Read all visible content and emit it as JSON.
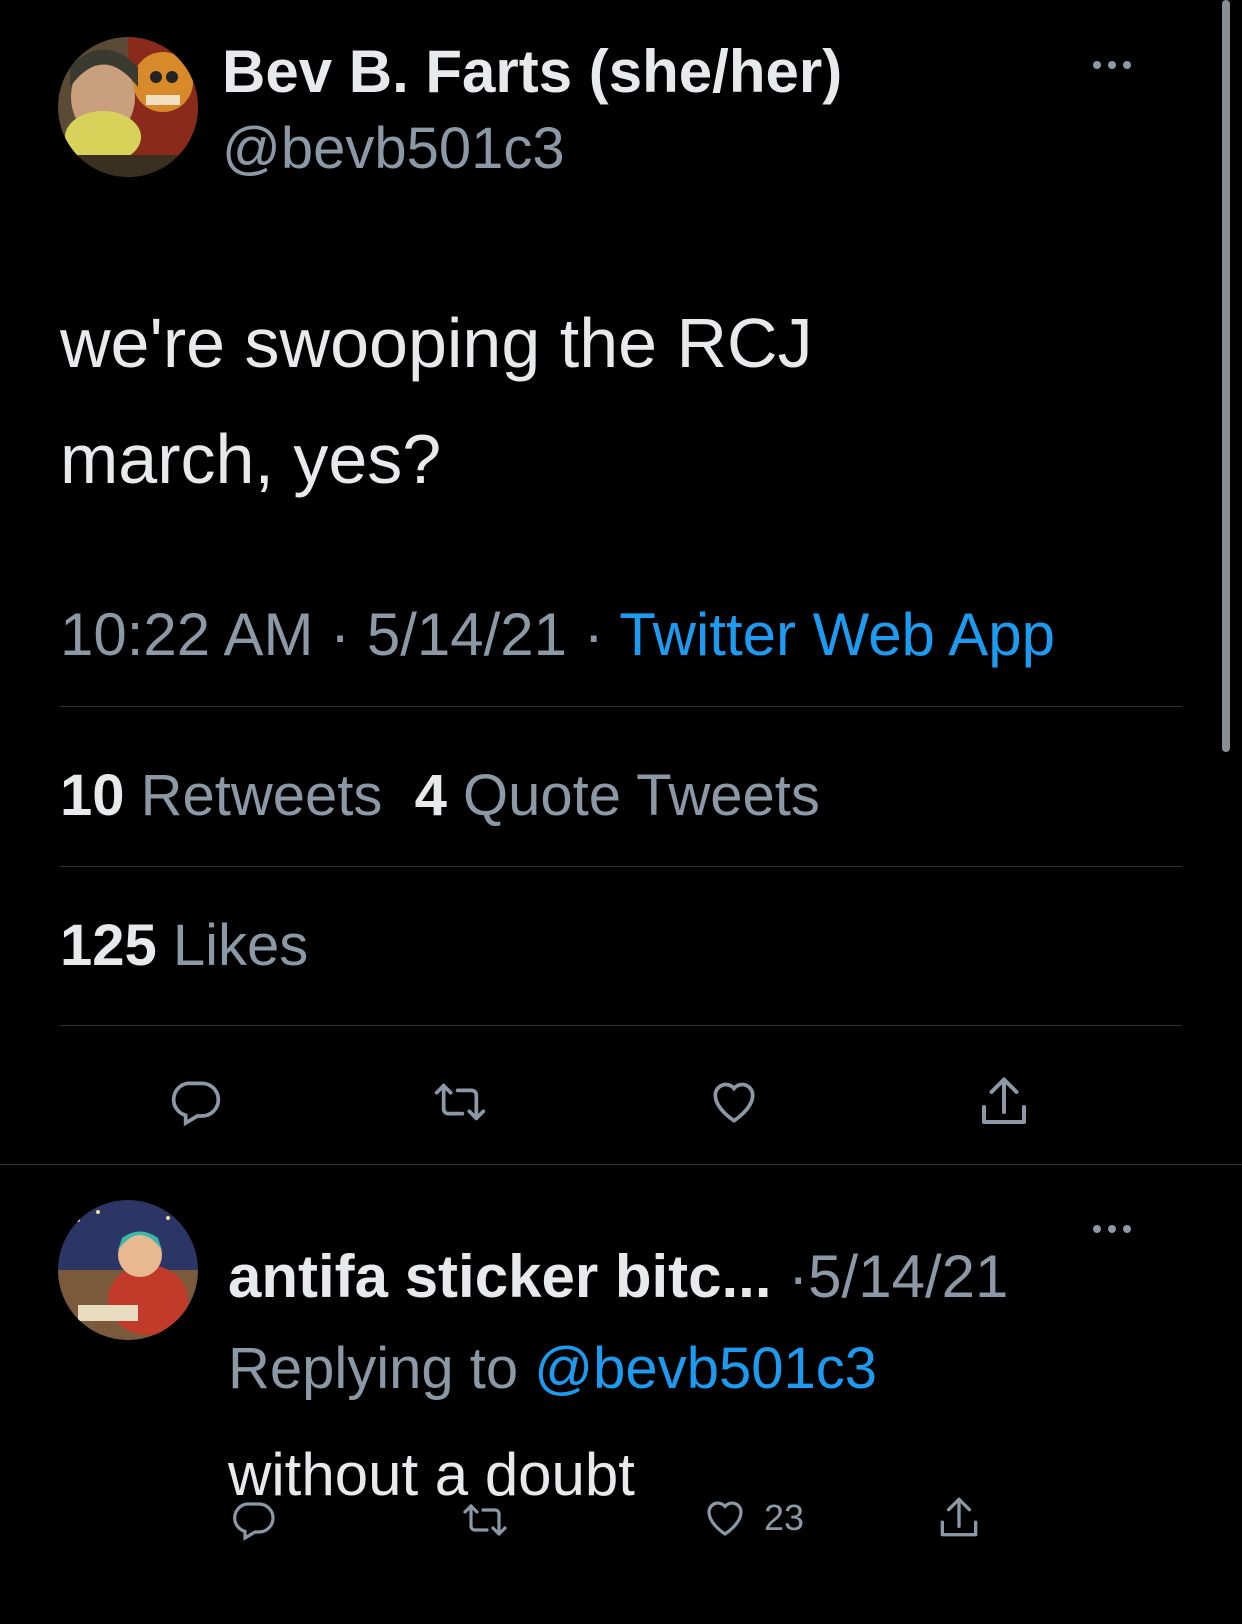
{
  "tweet": {
    "author_name": "Bev B. Farts (she/her)",
    "author_handle": "@bevb501c3",
    "text_line1": "we're swooping the RCJ",
    "text_line2": "march, yes?",
    "time": "10:22 AM",
    "sep1": " · ",
    "date": "5/14/21",
    "sep2": " · ",
    "source": "Twitter Web App",
    "retweets_count": "10",
    "retweets_label": "Retweets",
    "quotes_count": "4",
    "quotes_label": "Quote Tweets",
    "likes_count": "125",
    "likes_label": "Likes"
  },
  "reply": {
    "author_name": "antifa sticker bitc...",
    "date": "·5/14/21",
    "replying_prefix": "Replying to ",
    "replying_handle": "@bevb501c3",
    "text": "without a doubt",
    "like_count": "23"
  },
  "colors": {
    "background": "#000000",
    "text": "#e7e9ea",
    "secondary": "#8b98a5",
    "link": "#1d9bf0",
    "divider": "#2f3336"
  },
  "icons": [
    "more-icon",
    "reply-icon",
    "retweet-icon",
    "like-icon",
    "share-icon"
  ]
}
